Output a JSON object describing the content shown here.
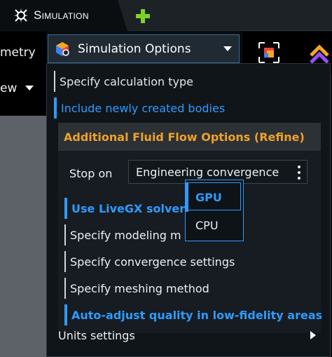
{
  "tabbar": {
    "active_tab": "Simulation",
    "add_tab_symbol": "+"
  },
  "left_ribbon": {
    "geometry_label": "metry",
    "view_label": "ew"
  },
  "toolbar": {
    "sim_options_label": "Simulation Options"
  },
  "menu": {
    "items": [
      {
        "label": "Specify calculation type",
        "highlighted": false
      },
      {
        "label": "Include newly created bodies",
        "highlighted": true
      }
    ],
    "units_label": "Units settings"
  },
  "fluid_options": {
    "header": "Additional Fluid Flow Options (Refine)",
    "stop_on_label": "Stop on",
    "stop_on_value": "Engineering convergence",
    "items": [
      {
        "label": "Use LiveGX solver",
        "highlighted": true
      },
      {
        "label": "Specify modeling m",
        "highlighted": false
      },
      {
        "label": "Specify convergence settings",
        "highlighted": false
      },
      {
        "label": "Specify meshing method",
        "highlighted": false
      },
      {
        "label": "Auto-adjust quality in low-fidelity areas",
        "highlighted": true
      }
    ]
  },
  "solver_popup": {
    "options": [
      "GPU",
      "CPU"
    ],
    "selected": "GPU"
  },
  "colors": {
    "accent_blue": "#2f9bff",
    "header_orange": "#f0a12a",
    "add_green": "#7ed321"
  },
  "icons": {
    "simulation_tab_icon": "spark-gear-icon",
    "add_tab_icon": "plus-icon",
    "sim_options_icon": "cube-settings-icon",
    "units_icon": "chevron-right-icon"
  }
}
